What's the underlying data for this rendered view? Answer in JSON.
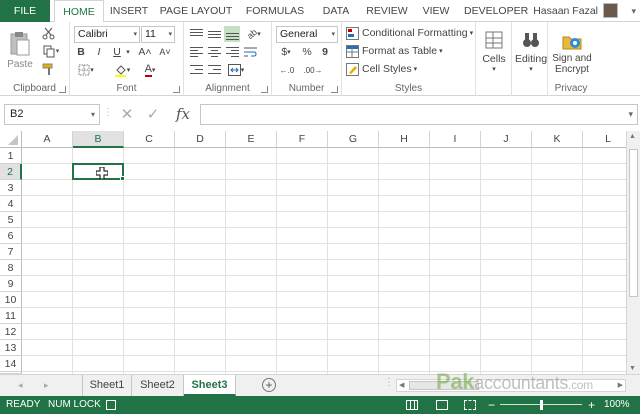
{
  "ribbon_tabs": [
    "FILE",
    "HOME",
    "INSERT",
    "PAGE LAYOUT",
    "FORMULAS",
    "DATA",
    "REVIEW",
    "VIEW",
    "DEVELOPER"
  ],
  "user": {
    "name": "Hasaan Fazal"
  },
  "ribbon": {
    "clipboard": {
      "paste": "Paste",
      "label": "Clipboard"
    },
    "font": {
      "family": "Calibri",
      "size": "11",
      "bold": "B",
      "italic": "I",
      "underline": "U",
      "grow": "A˄",
      "shrink": "A˅",
      "label": "Font"
    },
    "alignment": {
      "label": "Alignment"
    },
    "number": {
      "format": "General",
      "currency": "$",
      "percent": "%",
      "comma": "9",
      "label": "Number"
    },
    "styles": {
      "conditional": "Conditional Formatting",
      "table": "Format as Table",
      "cell_styles": "Cell Styles",
      "label": "Styles"
    },
    "cells": {
      "label_btn": "Cells"
    },
    "editing": {
      "label_btn": "Editing"
    },
    "privacy": {
      "sign": "Sign and",
      "encrypt": "Encrypt",
      "label": "Privacy"
    }
  },
  "formula_bar": {
    "name_box": "B2",
    "fx": "fx",
    "value": ""
  },
  "grid": {
    "columns": [
      "A",
      "B",
      "C",
      "D",
      "E",
      "F",
      "G",
      "H",
      "I",
      "J",
      "K",
      "L"
    ],
    "rows": [
      "1",
      "2",
      "3",
      "4",
      "5",
      "6",
      "7",
      "8",
      "9",
      "10",
      "11",
      "12",
      "13",
      "14"
    ],
    "active_cell": "B2"
  },
  "sheets": [
    "Sheet1",
    "Sheet2",
    "Sheet3"
  ],
  "active_sheet": "Sheet3",
  "status": {
    "ready": "READY",
    "numlock": "NUM LOCK",
    "zoom": "100%"
  },
  "watermark": "Pakaccountants.com",
  "colors": {
    "accent": "#217346"
  }
}
